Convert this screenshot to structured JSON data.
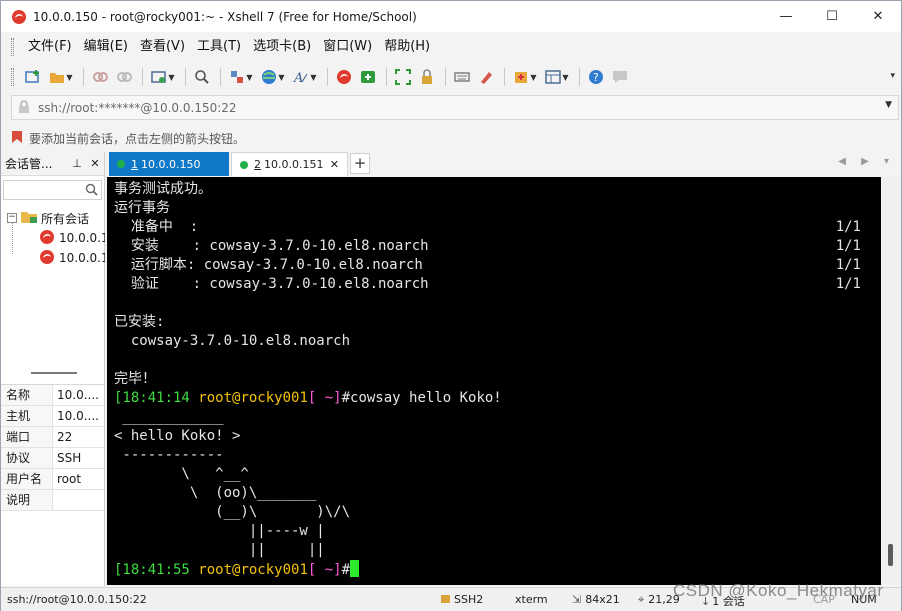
{
  "window": {
    "title": "10.0.0.150 - root@rocky001:~ - Xshell 7 (Free for Home/School)",
    "minimize": "—",
    "maximize": "☐",
    "close": "✕"
  },
  "menu": [
    "文件(F)",
    "编辑(E)",
    "查看(V)",
    "工具(T)",
    "选项卡(B)",
    "窗口(W)",
    "帮助(H)"
  ],
  "address": {
    "value": "ssh://root:*******@10.0.0.150:22"
  },
  "hint": "要添加当前会话，点击左侧的箭头按钮。",
  "session_panel": {
    "title": "会话管...",
    "pin": "⊥",
    "close": "✕",
    "tree": {
      "root_label": "所有会话",
      "items": [
        "10.0.0.1",
        "10.0.0.1"
      ]
    },
    "properties": [
      {
        "key": "名称",
        "value": "10.0...."
      },
      {
        "key": "主机",
        "value": "10.0...."
      },
      {
        "key": "端口",
        "value": "22"
      },
      {
        "key": "协议",
        "value": "SSH"
      },
      {
        "key": "用户名",
        "value": "root"
      },
      {
        "key": "说明",
        "value": ""
      }
    ]
  },
  "tabs": [
    {
      "num": "1",
      "label": "10.0.0.150"
    },
    {
      "num": "2",
      "label": "10.0.0.151"
    }
  ],
  "tab_add": "+",
  "tab_nav": "◀ ▶ ▾",
  "terminal": {
    "lines": [
      {
        "text": "事务测试成功。"
      },
      {
        "text": "运行事务"
      },
      {
        "text": "  准备中  :",
        "right": "1/1"
      },
      {
        "text": "  安装    : cowsay-3.7.0-10.el8.noarch",
        "right": "1/1"
      },
      {
        "text": "  运行脚本: cowsay-3.7.0-10.el8.noarch",
        "right": "1/1"
      },
      {
        "text": "  验证    : cowsay-3.7.0-10.el8.noarch",
        "right": "1/1"
      },
      {
        "text": ""
      },
      {
        "text": "已安装:"
      },
      {
        "text": "  cowsay-3.7.0-10.el8.noarch"
      },
      {
        "text": ""
      },
      {
        "text": "完毕！"
      }
    ],
    "prompt1": {
      "time": "[18:41:14",
      "user": "root@rocky001",
      "dir": "[ ~]",
      "cmd": "#cowsay hello Koko!"
    },
    "cow": [
      " ____________",
      "< hello Koko! >",
      " ------------",
      "        \\   ^__^",
      "         \\  (oo)\\_______",
      "            (__)\\       )\\/\\",
      "                ||----w |",
      "                ||     ||"
    ],
    "prompt2": {
      "time": "[18:41:55",
      "user": "root@rocky001",
      "dir": "[ ~]",
      "cmd": "#"
    }
  },
  "status": {
    "connection": "ssh://root@10.0.0.150:22",
    "protocol": "SSH2",
    "terminal_type": "xterm",
    "size": "84x21",
    "position": "21,29",
    "sessions": "1 会话",
    "cap": "CAP",
    "num": "NUM"
  },
  "watermark": "CSDN @Koko_Hekmatyar",
  "colors": {
    "tab_active": "#1078c8",
    "prompt_green": "#3fdc3f",
    "prompt_yellow": "#f4c20d",
    "prompt_magenta": "#ff5ad9"
  }
}
